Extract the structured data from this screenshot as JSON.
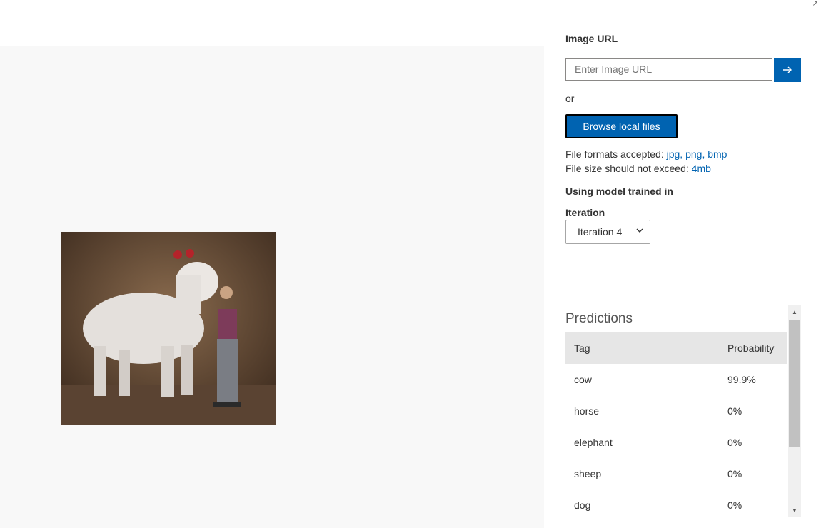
{
  "upload": {
    "url_label": "Image URL",
    "url_placeholder": "Enter Image URL",
    "or_text": "or",
    "browse_label": "Browse local files",
    "formats_prefix": "File formats accepted: ",
    "formats": [
      "jpg,",
      "png,",
      "bmp"
    ],
    "size_prefix": "File size should not exceed: ",
    "size_limit": "4mb"
  },
  "model": {
    "heading": "Using model trained in",
    "iteration_label": "Iteration",
    "iteration_value": "Iteration 4"
  },
  "predictions": {
    "title": "Predictions",
    "columns": [
      "Tag",
      "Probability"
    ],
    "rows": [
      {
        "tag": "cow",
        "probability": "99.9%"
      },
      {
        "tag": "horse",
        "probability": "0%"
      },
      {
        "tag": "elephant",
        "probability": "0%"
      },
      {
        "tag": "sheep",
        "probability": "0%"
      },
      {
        "tag": "dog",
        "probability": "0%"
      }
    ]
  },
  "colors": {
    "accent": "#0063b1",
    "header_bg": "#e6e6e6",
    "preview_bg": "#f8f8f8"
  },
  "icons": {
    "submit": "arrow-right-icon",
    "select": "chevron-down-icon",
    "resize": "resize-grip-icon"
  }
}
